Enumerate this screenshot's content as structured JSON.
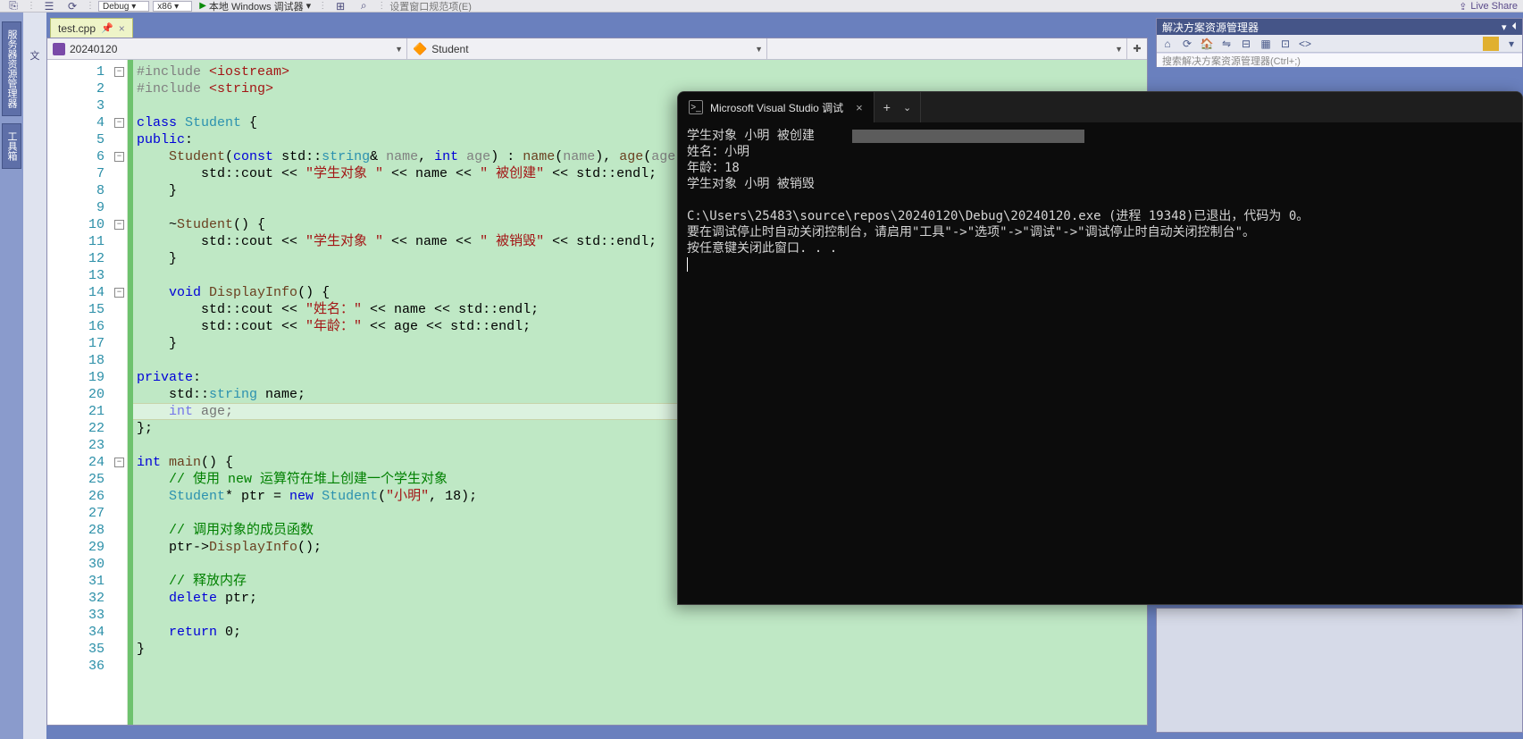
{
  "toolbar": {
    "config": "Debug",
    "platform": "x86",
    "run_label": "本地 Windows 调试器",
    "misc_label": "设置窗口规范项(E)",
    "live_share": "Live Share"
  },
  "left_tabs": {
    "t1": "服务器资源管理器",
    "t2": "工具箱"
  },
  "far_left_hint": "文",
  "tab": {
    "filename": "test.cpp"
  },
  "navbar": {
    "project": "20240120",
    "class": "Student",
    "member": ""
  },
  "solution": {
    "title": "解决方案资源管理器",
    "search_placeholder": "搜索解决方案资源管理器(Ctrl+;)"
  },
  "code": {
    "lines": [
      {
        "n": "1",
        "fold": "-",
        "html": "<span class='kw-gray'>#include</span> <span class='kw-str'>&lt;iostream&gt;</span>"
      },
      {
        "n": "2",
        "fold": "",
        "html": "<span class='kw-gray'>#include</span> <span class='kw-str'>&lt;string&gt;</span>"
      },
      {
        "n": "3",
        "fold": "",
        "html": ""
      },
      {
        "n": "4",
        "fold": "-",
        "html": "<span class='kw-blue'>class</span> <span class='kw-teal'>Student</span> {"
      },
      {
        "n": "5",
        "fold": "",
        "html": "<span class='kw-blue'>public</span>:"
      },
      {
        "n": "6",
        "fold": "-",
        "html": "    <span class='kw-func'>Student</span>(<span class='kw-blue'>const</span> std::<span class='kw-teal'>string</span>&amp; <span class='kw-gray'>name</span>, <span class='kw-blue'>int</span> <span class='kw-gray'>age</span>) : <span class='kw-func'>name</span>(<span class='kw-gray'>name</span>), <span class='kw-func'>age</span>(<span class='kw-gray'>age</span>) {"
      },
      {
        "n": "7",
        "fold": "",
        "html": "        std::cout &lt;&lt; <span class='kw-str'>\"学生对象 \"</span> &lt;&lt; name &lt;&lt; <span class='kw-str'>\" 被创建\"</span> &lt;&lt; std::endl;"
      },
      {
        "n": "8",
        "fold": "",
        "html": "    }"
      },
      {
        "n": "9",
        "fold": "",
        "html": ""
      },
      {
        "n": "10",
        "fold": "-",
        "html": "    ~<span class='kw-func'>Student</span>() {"
      },
      {
        "n": "11",
        "fold": "",
        "html": "        std::cout &lt;&lt; <span class='kw-str'>\"学生对象 \"</span> &lt;&lt; name &lt;&lt; <span class='kw-str'>\" 被销毁\"</span> &lt;&lt; std::endl;"
      },
      {
        "n": "12",
        "fold": "",
        "html": "    }"
      },
      {
        "n": "13",
        "fold": "",
        "html": ""
      },
      {
        "n": "14",
        "fold": "-",
        "html": "    <span class='kw-blue'>void</span> <span class='kw-func'>DisplayInfo</span>() {"
      },
      {
        "n": "15",
        "fold": "",
        "html": "        std::cout &lt;&lt; <span class='kw-str'>\"姓名：\"</span> &lt;&lt; name &lt;&lt; std::endl;"
      },
      {
        "n": "16",
        "fold": "",
        "html": "        std::cout &lt;&lt; <span class='kw-str'>\"年龄：\"</span> &lt;&lt; age &lt;&lt; std::endl;"
      },
      {
        "n": "17",
        "fold": "",
        "html": "    }"
      },
      {
        "n": "18",
        "fold": "",
        "html": ""
      },
      {
        "n": "19",
        "fold": "",
        "html": "<span class='kw-blue'>private</span>:"
      },
      {
        "n": "20",
        "fold": "",
        "html": "    std::<span class='kw-teal'>string</span> name;"
      },
      {
        "n": "21",
        "fold": "",
        "html": "    <span class='kw-blue'>int</span> age;"
      },
      {
        "n": "22",
        "fold": "",
        "html": "};"
      },
      {
        "n": "23",
        "fold": "",
        "html": ""
      },
      {
        "n": "24",
        "fold": "-",
        "html": "<span class='kw-blue'>int</span> <span class='kw-func'>main</span>() {"
      },
      {
        "n": "25",
        "fold": "",
        "html": "    <span class='kw-com'>// 使用 new 运算符在堆上创建一个学生对象</span>"
      },
      {
        "n": "26",
        "fold": "",
        "html": "    <span class='kw-teal'>Student</span>* ptr = <span class='kw-blue'>new</span> <span class='kw-teal'>Student</span>(<span class='kw-str'>\"小明\"</span>, 18);"
      },
      {
        "n": "27",
        "fold": "",
        "html": ""
      },
      {
        "n": "28",
        "fold": "",
        "html": "    <span class='kw-com'>// 调用对象的成员函数</span>"
      },
      {
        "n": "29",
        "fold": "",
        "html": "    ptr-&gt;<span class='kw-func'>DisplayInfo</span>();"
      },
      {
        "n": "30",
        "fold": "",
        "html": ""
      },
      {
        "n": "31",
        "fold": "",
        "html": "    <span class='kw-com'>// 释放内存</span>"
      },
      {
        "n": "32",
        "fold": "",
        "html": "    <span class='kw-blue'>delete</span> ptr;"
      },
      {
        "n": "33",
        "fold": "",
        "html": ""
      },
      {
        "n": "34",
        "fold": "",
        "html": "    <span class='kw-blue'>return</span> 0;"
      },
      {
        "n": "35",
        "fold": "",
        "html": "}"
      },
      {
        "n": "36",
        "fold": "",
        "html": ""
      }
    ],
    "current_line_index": 20
  },
  "console": {
    "title": "Microsoft Visual Studio 调试",
    "lines": [
      "学生对象 小明 被创建     [REDACT]",
      "姓名：小明",
      "年龄：18",
      "学生对象 小明 被销毁",
      "",
      "C:\\Users\\25483\\source\\repos\\20240120\\Debug\\20240120.exe (进程 19348)已退出，代码为 0。",
      "要在调试停止时自动关闭控制台，请启用\"工具\"->\"选项\"->\"调试\"->\"调试停止时自动关闭控制台\"。",
      "按任意键关闭此窗口. . ."
    ]
  }
}
